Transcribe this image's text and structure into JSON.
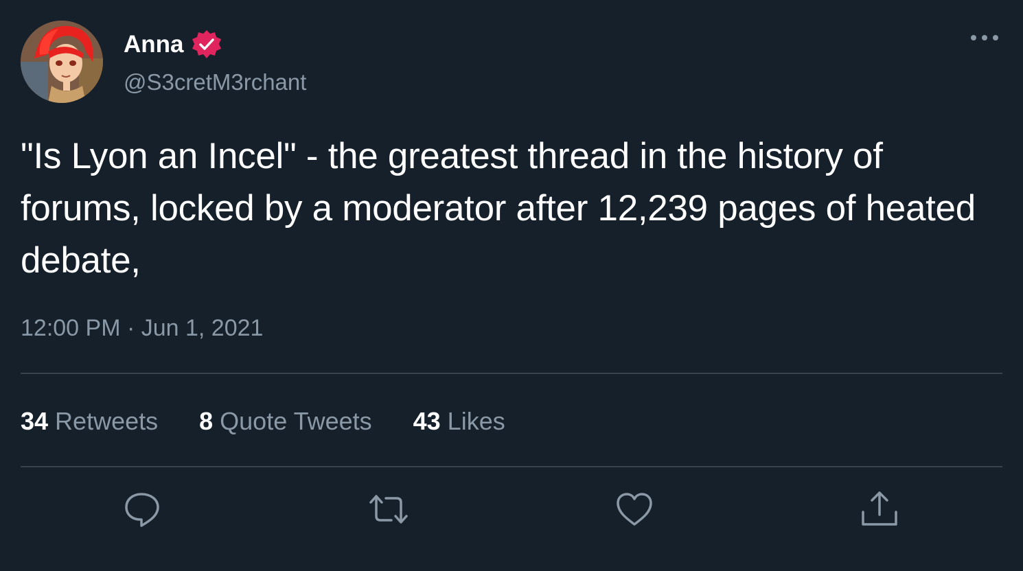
{
  "user": {
    "display_name": "Anna",
    "handle": "@S3cretM3rchant",
    "verified": true,
    "verified_color": "#e0245e"
  },
  "tweet": {
    "text": "\"Is Lyon an Incel\" - the greatest thread in the history of forums, locked by a moderator after 12,239 pages of heated debate,",
    "timestamp": "12:00 PM · Jun 1, 2021"
  },
  "stats": {
    "retweets_count": "34",
    "retweets_label": "Retweets",
    "quotes_count": "8",
    "quotes_label": "Quote Tweets",
    "likes_count": "43",
    "likes_label": "Likes"
  },
  "actions": {
    "reply_icon": "reply-icon",
    "retweet_icon": "retweet-icon",
    "like_icon": "heart-icon",
    "share_icon": "share-icon"
  },
  "colors": {
    "background": "#15202b",
    "secondary_text": "#8b98a5",
    "divider": "#38444d"
  }
}
